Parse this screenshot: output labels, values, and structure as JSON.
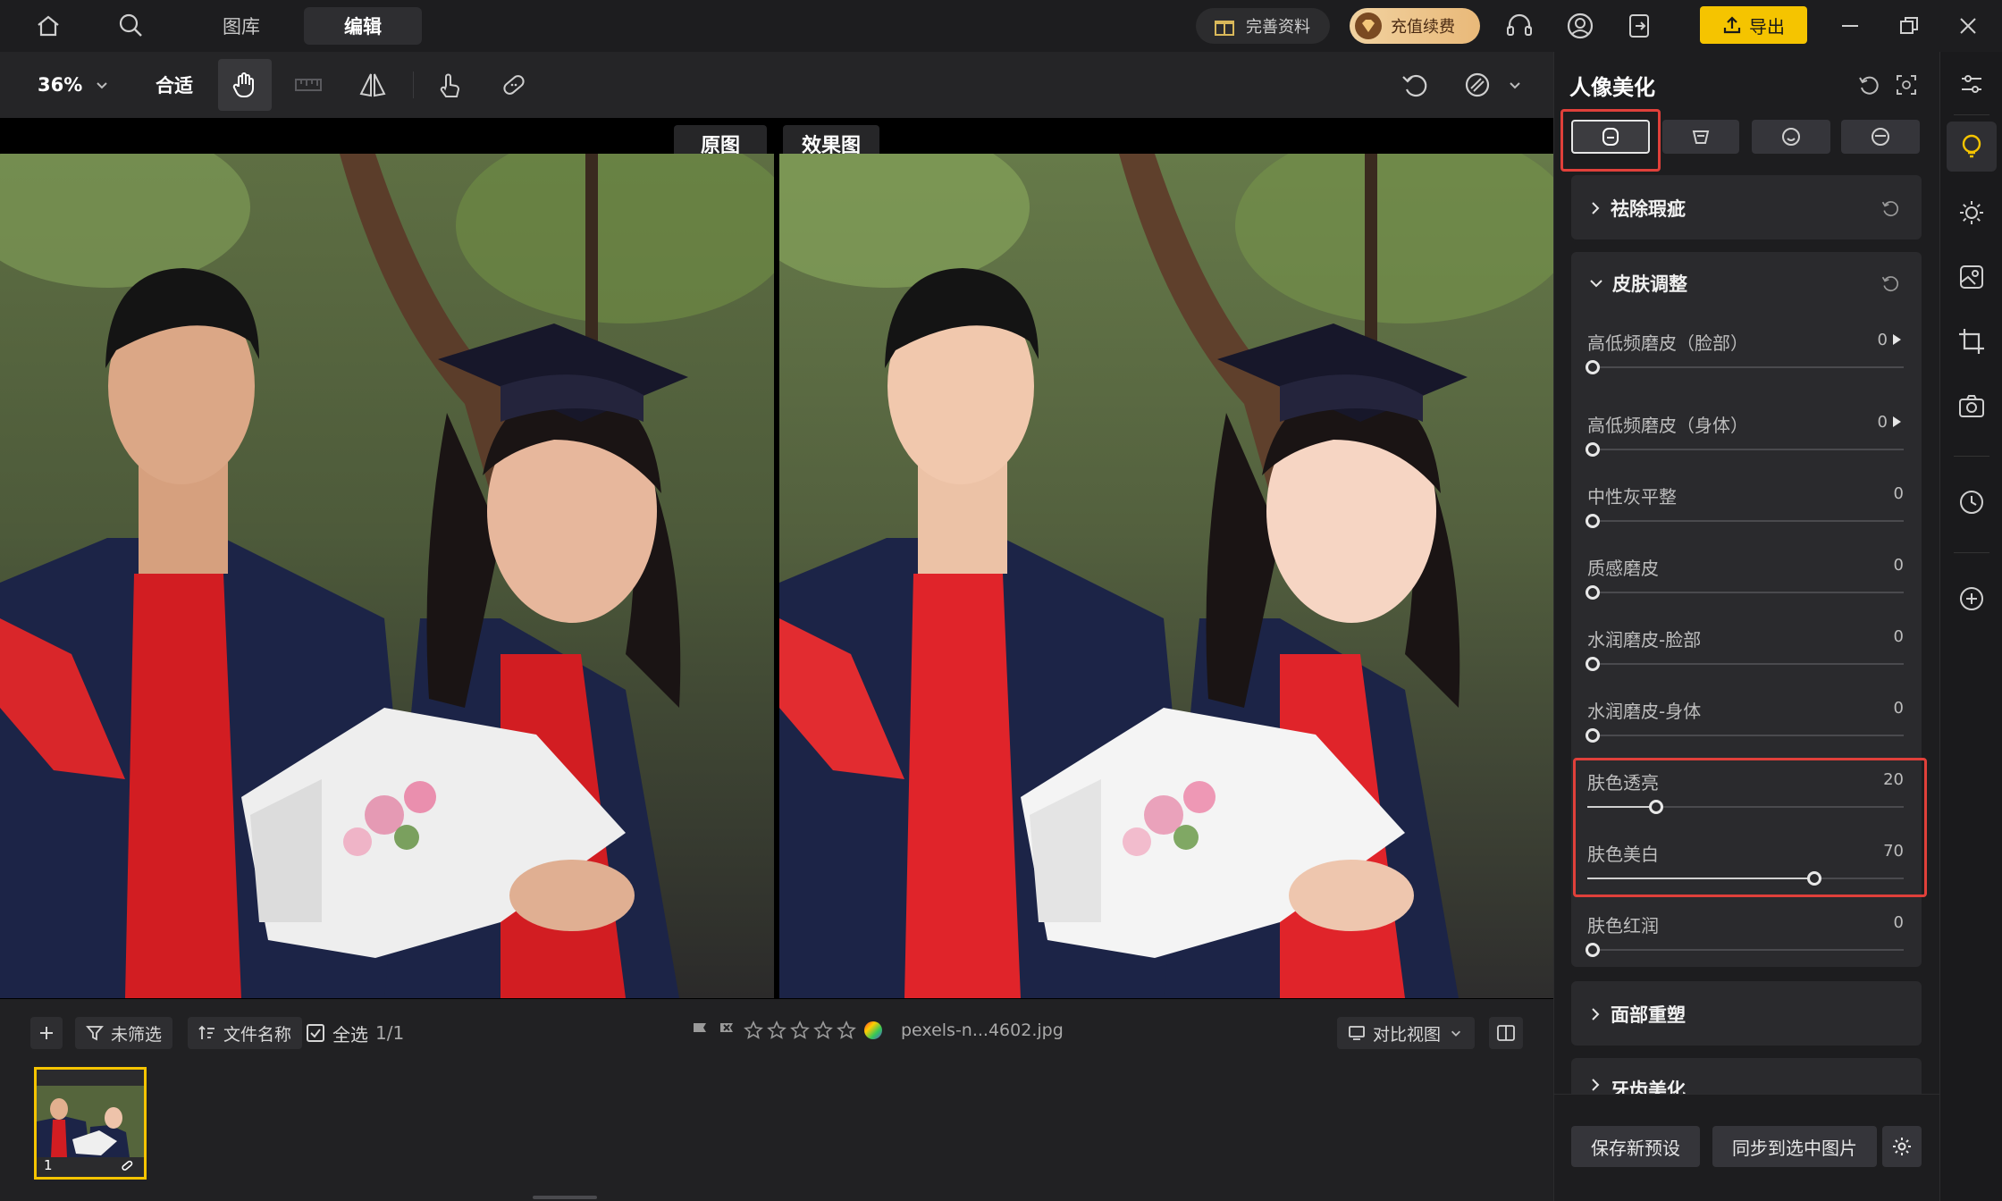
{
  "nav": {
    "tabs": [
      {
        "label": "图库",
        "active": false
      },
      {
        "label": "编辑",
        "active": true
      }
    ],
    "profile_label": "完善资料",
    "vip_label": "充值续费",
    "export_label": "导出"
  },
  "toolbar": {
    "zoom": "36%",
    "fit_label": "合适"
  },
  "compare": {
    "before_label": "原图",
    "after_label": "效果图"
  },
  "bottom": {
    "filter_label": "未筛选",
    "sort_label": "文件名称",
    "select_all_label": "全选",
    "count": "1/1",
    "rating_stars": 0,
    "filename": "pexels-n...4602.jpg",
    "view_mode_label": "对比视图",
    "thumb_index": "1"
  },
  "panel": {
    "title": "人像美化",
    "sections": {
      "blemish": "祛除瑕疵",
      "skin": "皮肤调整",
      "face": "面部重塑",
      "teeth": "牙齿美化"
    },
    "sliders": [
      {
        "label": "高低频磨皮（脸部）",
        "value": "0",
        "has_arrow": true,
        "fraction": 0
      },
      {
        "label": "高低频磨皮（身体）",
        "value": "0",
        "has_arrow": true,
        "fraction": 0
      },
      {
        "label": "中性灰平整",
        "value": "0",
        "fraction": 0
      },
      {
        "label": "质感磨皮",
        "value": "0",
        "fraction": 0
      },
      {
        "label": "水润磨皮-脸部",
        "value": "0",
        "fraction": 0
      },
      {
        "label": "水润磨皮-身体",
        "value": "0",
        "fraction": 0
      },
      {
        "label": "肤色透亮",
        "value": "20",
        "fraction": 0.2
      },
      {
        "label": "肤色美白",
        "value": "70",
        "fraction": 0.7
      },
      {
        "label": "肤色红润",
        "value": "0",
        "fraction": 0
      }
    ],
    "save_preset_label": "保存新预设",
    "sync_label": "同步到选中图片"
  },
  "colors": {
    "accent": "#f5c400",
    "highlight_box": "#e0403a",
    "selected_thumb_border": "#f5c400"
  }
}
